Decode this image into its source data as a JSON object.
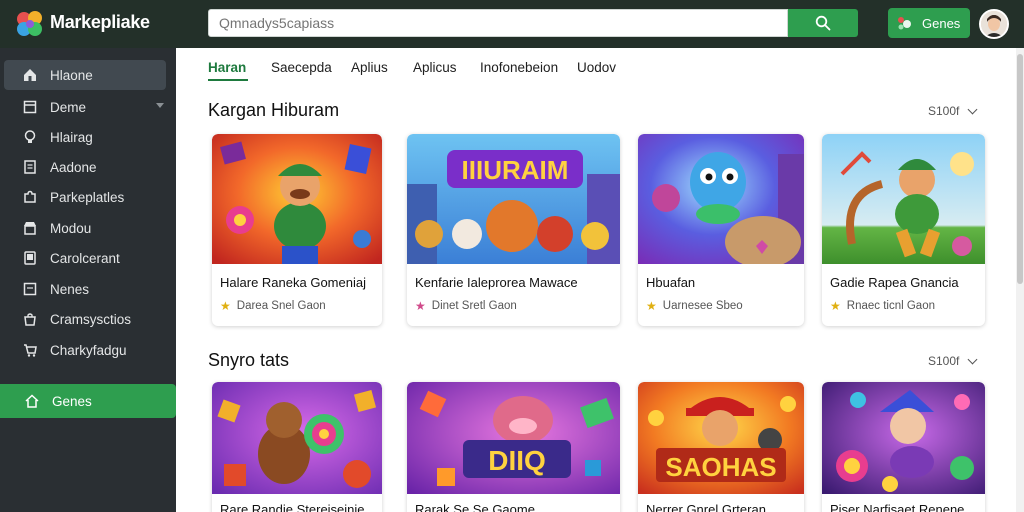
{
  "app": {
    "brand": "Markepliake"
  },
  "search": {
    "placeholder": "Qmnadys5capiass"
  },
  "header": {
    "games_label": "Genes"
  },
  "sidebar": {
    "items": [
      {
        "label": "Hlaone",
        "icon": "home-icon"
      },
      {
        "label": "Deme",
        "icon": "game-icon"
      },
      {
        "label": "Hlairag",
        "icon": "bulb-icon"
      },
      {
        "label": "Aadone",
        "icon": "document-icon"
      },
      {
        "label": "Parkeplatles",
        "icon": "puzzle-icon"
      },
      {
        "label": "Modou",
        "icon": "store-icon"
      },
      {
        "label": "Carolcerant",
        "icon": "tablet-icon"
      },
      {
        "label": "Nenes",
        "icon": "note-icon"
      },
      {
        "label": "Cramsysctios",
        "icon": "bag-icon"
      },
      {
        "label": "Charkyfadgu",
        "icon": "cart-icon"
      }
    ],
    "games_item": {
      "label": "Genes",
      "icon": "home-outline-icon"
    }
  },
  "tabs": [
    "Haran",
    "Saecepda",
    "Aplius",
    "Aplicus",
    "Inofonebeion",
    "Uodov"
  ],
  "sections": [
    {
      "title": "Kargan Hiburam",
      "more": "S100f",
      "cards": [
        {
          "title": "Halare Raneka Gomeniaj",
          "sub": "Darea Snel Gaon",
          "star_color": "#e0b012"
        },
        {
          "title": "Kenfarie Ialeprorea Mawace",
          "sub": "Dinet Sretl Gaon",
          "star_color": "#d04a8a"
        },
        {
          "title": "Hbuafan",
          "sub": "Uarnesee Sbeo",
          "star_color": "#e0b012"
        },
        {
          "title": "Gadie Rapea Gnancia",
          "sub": "Rnaec ticnl Gaon",
          "star_color": "#e0b012"
        }
      ]
    },
    {
      "title": "Snyro tats",
      "more": "S100f",
      "cards": [
        {
          "title": "Rare Randie Stereiseinie"
        },
        {
          "title": "Rarak Se Se Gaome"
        },
        {
          "title": "Nerrer Gnrel Grteran"
        },
        {
          "title": "Piser Narfisaet Renene"
        }
      ]
    }
  ],
  "banner_text": {
    "card_1_2": "IIIURAIM",
    "card_2_2": "DIIQ",
    "card_2_3": "SAOHAS"
  },
  "colors": {
    "topbar": "#233029",
    "sidebar": "#2a2f33",
    "accent": "#2e9e4f",
    "active_tab": "#1e7a3e"
  }
}
